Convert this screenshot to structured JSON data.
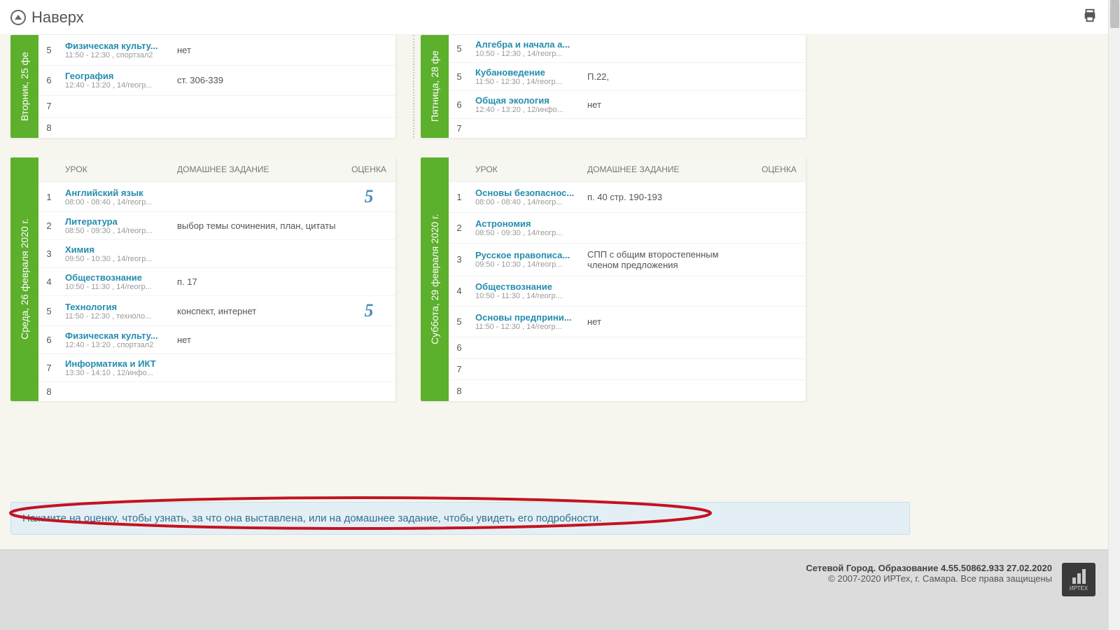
{
  "topbar": {
    "up_label": "Наверх"
  },
  "headers": {
    "lesson": "УРОК",
    "homework": "ДОМАШНЕЕ ЗАДАНИЕ",
    "grade": "ОЦЕНКА"
  },
  "info_text": "Нажмите на оценку, чтобы узнать, за что она выставлена, или на домашнее задание, чтобы увидеть его подробности.",
  "footer": {
    "line1": "Сетевой Город. Образование  4.55.50862.933  27.02.2020",
    "line2": "© 2007-2020 ИРТех, г. Самара. Все права защищены",
    "logo_caption": "ИРТЕХ"
  },
  "days": {
    "tue": {
      "label": "Вторник, 25 фе",
      "rows": [
        {
          "n": "5",
          "subject": "Физическая культу...",
          "time": "11:50 - 12:30 , спортзал2",
          "hw": "нет",
          "grade": ""
        },
        {
          "n": "6",
          "subject": "География",
          "time": "12:40 - 13:20 , 14/геогр...",
          "hw": "ст. 306-339",
          "grade": ""
        },
        {
          "n": "7",
          "subject": "",
          "time": "",
          "hw": "",
          "grade": ""
        },
        {
          "n": "8",
          "subject": "",
          "time": "",
          "hw": "",
          "grade": ""
        }
      ]
    },
    "fri": {
      "label": "Пятница, 28 фе",
      "rows": [
        {
          "n": "5",
          "subject": "Алгебра и начала а...",
          "time": "10:50 - 12:30 , 14/геогр...",
          "hw": "",
          "grade": ""
        },
        {
          "n": "5",
          "subject": "Кубановедение",
          "time": "11:50 - 12:30 , 14/геогр...",
          "hw": "П.22,",
          "grade": ""
        },
        {
          "n": "6",
          "subject": "Общая экология",
          "time": "12:40 - 13:20 , 12/инфо...",
          "hw": "нет",
          "grade": ""
        },
        {
          "n": "7",
          "subject": "",
          "time": "",
          "hw": "",
          "grade": ""
        }
      ]
    },
    "wed": {
      "label": "Среда, 26 февраля 2020 г.",
      "rows": [
        {
          "n": "1",
          "subject": "Английский язык",
          "time": "08:00 - 08:40 , 14/геогр...",
          "hw": "",
          "grade": "5"
        },
        {
          "n": "2",
          "subject": "Литература",
          "time": "08:50 - 09:30 , 14/геогр...",
          "hw": "выбор темы сочинения, план, цитаты",
          "grade": ""
        },
        {
          "n": "3",
          "subject": "Химия",
          "time": "09:50 - 10:30 , 14/геогр...",
          "hw": "",
          "grade": ""
        },
        {
          "n": "4",
          "subject": "Обществознание",
          "time": "10:50 - 11:30 , 14/геогр...",
          "hw": "п. 17",
          "grade": ""
        },
        {
          "n": "5",
          "subject": "Технология",
          "time": "11:50 - 12:30 , техноло...",
          "hw": "конспект, интернет",
          "grade": "5"
        },
        {
          "n": "6",
          "subject": "Физическая культу...",
          "time": "12:40 - 13:20 , спортзал2",
          "hw": "нет",
          "grade": ""
        },
        {
          "n": "7",
          "subject": "Информатика и ИКТ",
          "time": "13:30 - 14:10 , 12/инфо...",
          "hw": "",
          "grade": ""
        },
        {
          "n": "8",
          "subject": "",
          "time": "",
          "hw": "",
          "grade": ""
        }
      ]
    },
    "sat": {
      "label": "Суббота, 29 февраля 2020 г.",
      "rows": [
        {
          "n": "1",
          "subject": "Основы безопаснос...",
          "time": "08:00 - 08:40 , 14/геогр...",
          "hw": "п. 40 стр. 190-193",
          "grade": ""
        },
        {
          "n": "2",
          "subject": "Астрономия",
          "time": "08:50 - 09:30 , 14/геогр...",
          "hw": "",
          "grade": ""
        },
        {
          "n": "3",
          "subject": "Русское правописа...",
          "time": "09:50 - 10:30 , 14/геогр...",
          "hw": "СПП с общим второстепенным членом предложения",
          "grade": ""
        },
        {
          "n": "4",
          "subject": "Обществознание",
          "time": "10:50 - 11:30 , 14/геогр...",
          "hw": "",
          "grade": ""
        },
        {
          "n": "5",
          "subject": "Основы предприни...",
          "time": "11:50 - 12:30 , 14/геогр...",
          "hw": "нет",
          "grade": ""
        },
        {
          "n": "6",
          "subject": "",
          "time": "",
          "hw": "",
          "grade": ""
        },
        {
          "n": "7",
          "subject": "",
          "time": "",
          "hw": "",
          "grade": ""
        },
        {
          "n": "8",
          "subject": "",
          "time": "",
          "hw": "",
          "grade": ""
        }
      ]
    }
  }
}
